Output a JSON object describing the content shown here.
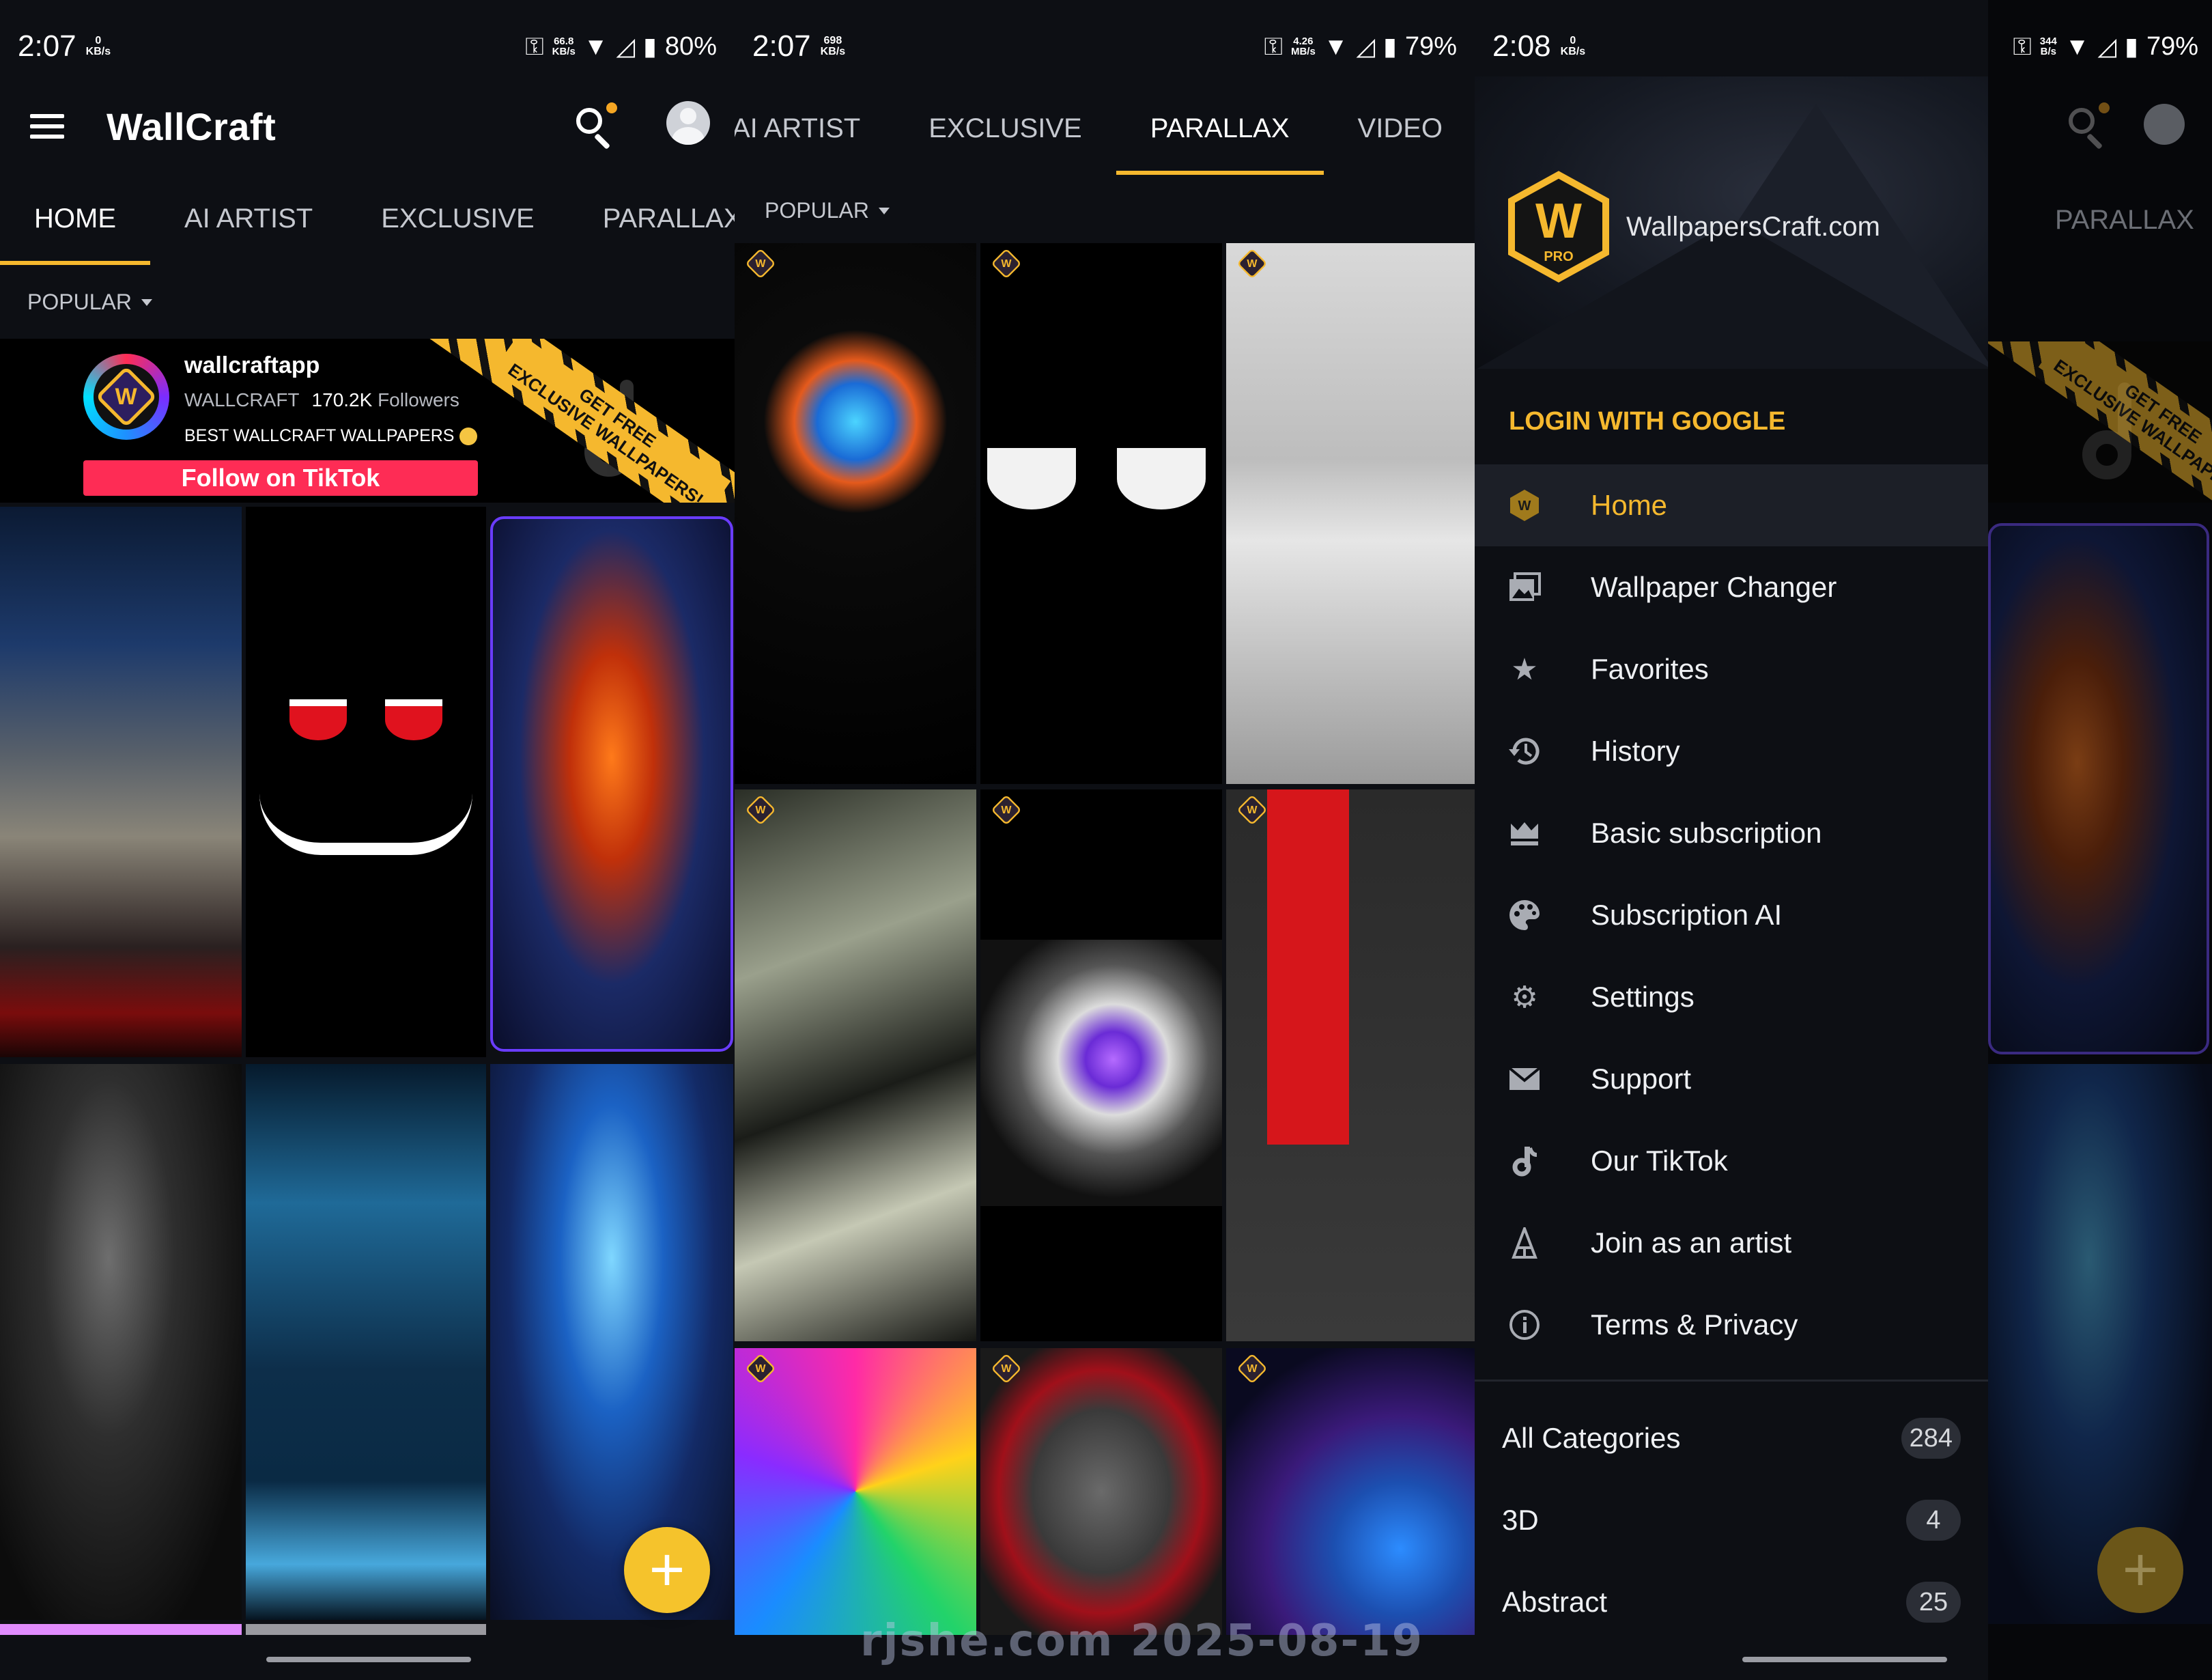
{
  "screens": [
    {
      "status": {
        "time": "2:07",
        "net_top": "0",
        "net_unit": "KB/s",
        "right_speed": "66.8",
        "right_unit": "KB/s",
        "battery": "80%"
      },
      "toolbar": {
        "title": "WallCraft"
      },
      "tabs": [
        "HOME",
        "AI ARTIST",
        "EXCLUSIVE",
        "PARALLAX"
      ],
      "active_tab": "HOME",
      "sort": "POPULAR",
      "banner": {
        "account": "wallcraftapp",
        "brand": "WALLCRAFT",
        "followers_count": "170.2K",
        "followers_label": "Followers",
        "description": "BEST WALLCRAFT WALLPAPERS",
        "button": "Follow on TikTok",
        "ribbon_line1": "GET FREE",
        "ribbon_line2": "EXCLUSIVE WALLPAPERS!"
      },
      "fab": "+"
    },
    {
      "status": {
        "time": "2:07",
        "net_top": "698",
        "net_unit": "KB/s",
        "right_speed": "4.26",
        "right_unit": "MB/s",
        "battery": "79%"
      },
      "tabs": [
        "AI ARTIST",
        "EXCLUSIVE",
        "PARALLAX",
        "VIDEO"
      ],
      "active_tab": "PARALLAX",
      "sort": "POPULAR",
      "badge_letter": "W"
    },
    {
      "status": {
        "time": "2:08",
        "net_top": "0",
        "net_unit": "KB/s"
      },
      "header": {
        "logo_letter": "W",
        "logo_sub": "PRO",
        "site": "WallpapersCraft.com"
      },
      "login": "LOGIN WITH GOOGLE",
      "menu": [
        {
          "icon": "home-icon",
          "label": "Home",
          "active": true
        },
        {
          "icon": "wallpaper-changer-icon",
          "label": "Wallpaper Changer"
        },
        {
          "icon": "star-icon",
          "label": "Favorites"
        },
        {
          "icon": "history-icon",
          "label": "History"
        },
        {
          "icon": "crown-icon",
          "label": "Basic subscription"
        },
        {
          "icon": "palette-icon",
          "label": "Subscription AI"
        },
        {
          "icon": "gear-icon",
          "label": "Settings"
        },
        {
          "icon": "mail-icon",
          "label": "Support"
        },
        {
          "icon": "tiktok-icon",
          "label": "Our TikTok"
        },
        {
          "icon": "artist-icon",
          "label": "Join as an artist"
        },
        {
          "icon": "info-icon",
          "label": "Terms & Privacy"
        }
      ],
      "categories": [
        {
          "label": "All Categories",
          "count": "284"
        },
        {
          "label": "3D",
          "count": "4"
        },
        {
          "label": "Abstract",
          "count": "25"
        }
      ]
    },
    {
      "status": {
        "right_speed": "344",
        "right_unit": "B/s",
        "battery": "79%"
      },
      "tab": "PARALLAX",
      "ribbon_line1": "GET FREE",
      "ribbon_line2": "EXCLUSIVE WALLPAPERS!",
      "fab": "+"
    }
  ],
  "watermark": "rjshe.com 2025-08-19",
  "colors": {
    "accent": "#f5b82e",
    "tiktok_red": "#fe2c55",
    "background": "#0d0f14"
  }
}
